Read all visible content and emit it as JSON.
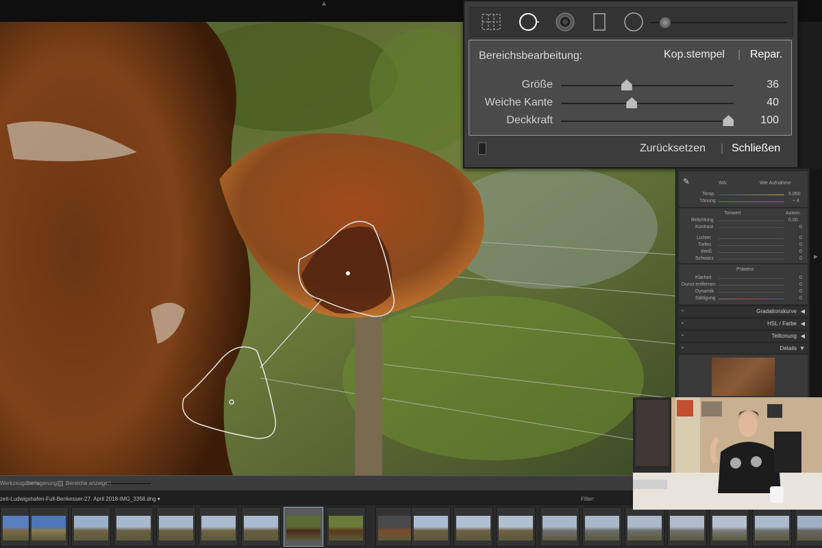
{
  "heal_panel": {
    "title": "Bereichsbearbeitung:",
    "mode_clone": "Kop.stempel",
    "mode_separator": "|",
    "mode_heal": "Repar.",
    "sliders": [
      {
        "label": "Größe",
        "value": "36",
        "fraction": 0.38
      },
      {
        "label": "Weiche Kante",
        "value": "40",
        "fraction": 0.41
      },
      {
        "label": "Deckkraft",
        "value": "100",
        "fraction": 0.97
      }
    ],
    "reset_label": "Zurücksetzen",
    "footer_separator": "|",
    "close_label": "Schließen",
    "tools": [
      "grid-overlay-icon",
      "spot-removal-icon",
      "red-eye-icon",
      "graduated-filter-icon",
      "radial-filter-icon",
      "adjustment-brush-slider"
    ]
  },
  "right_panel": {
    "wb_label": "WA:",
    "wb_value": "Wie Aufnahme",
    "temp_label": "Temp.",
    "temp_value": "5.050",
    "tint_label": "Tönung",
    "tint_value": "+ 4",
    "tone_label": "Tonwert",
    "tone_auto": "Autom.",
    "exposure_label": "Belichtung",
    "exposure_value": "0,00",
    "contrast_label": "Kontrast",
    "contrast_value": "0",
    "lights": [
      {
        "label": "Lichter",
        "value": "0"
      },
      {
        "label": "Tiefen",
        "value": "0"
      },
      {
        "label": "Weiß",
        "value": "0"
      },
      {
        "label": "Schwarz",
        "value": "0"
      }
    ],
    "presence_label": "Präsenz",
    "presence": [
      {
        "label": "Klarheit",
        "value": "0"
      },
      {
        "label": "Dunst entfernen",
        "value": "0"
      },
      {
        "label": "Dynamik",
        "value": "0"
      },
      {
        "label": "Sättigung",
        "value": "0"
      }
    ],
    "sections": [
      "Gradationskurve",
      "HSL / Farbe",
      "Teiltonung",
      "Details"
    ]
  },
  "status_bar": {
    "overlay_label": "Werkzeugüberlagerung :",
    "overlay_value": "Immer",
    "show_areas": "Bereiche anzeigen"
  },
  "filmstrip": {
    "path": "zeit-Ludwigshafen-Full-Benkesser-27. April 2018-IMG_3358.dng ▾",
    "filter_label": "Filter:"
  }
}
